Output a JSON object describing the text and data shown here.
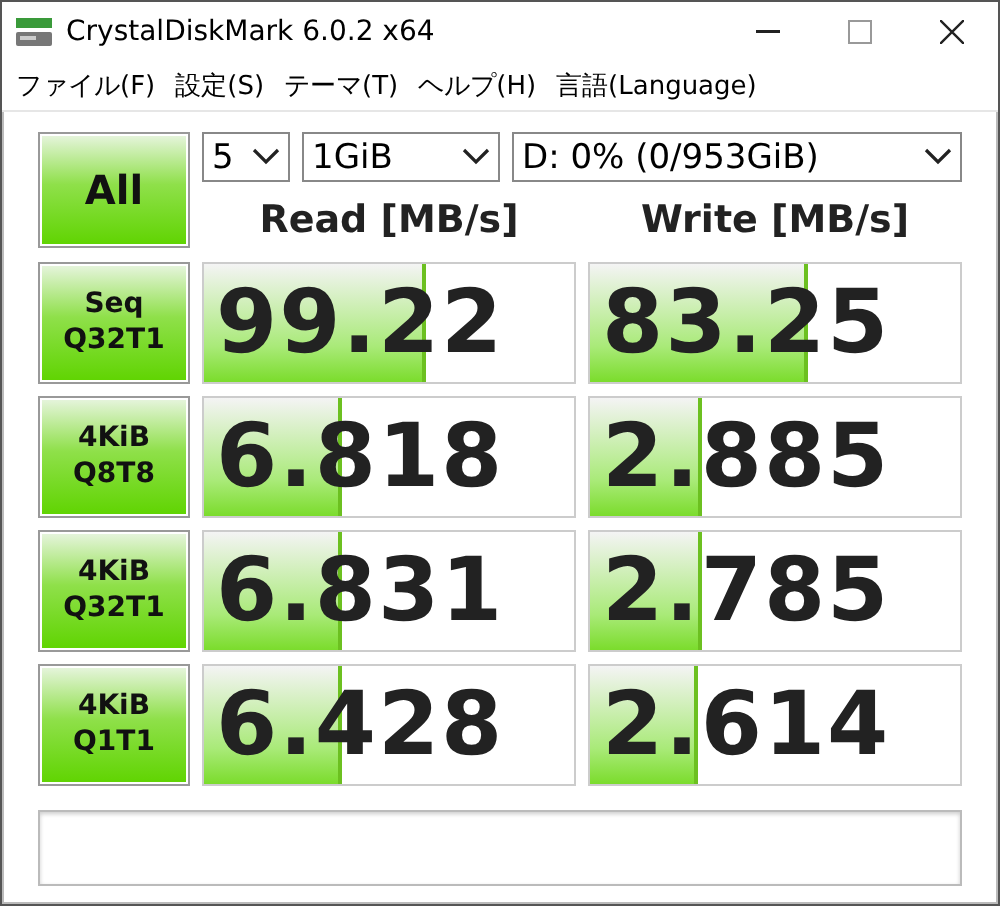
{
  "window": {
    "title": "CrystalDiskMark 6.0.2 x64"
  },
  "menu": [
    "ファイル(F)",
    "設定(S)",
    "テーマ(T)",
    "ヘルプ(H)",
    "言語(Language)"
  ],
  "all_button": "All",
  "selectors": [
    {
      "value": "5"
    },
    {
      "value": "1GiB"
    },
    {
      "value": "D: 0% (0/953GiB)"
    }
  ],
  "columns": [
    "Read [MB/s]",
    "Write [MB/s]"
  ],
  "rows": [
    {
      "label": "Seq Q32T1",
      "read": {
        "value": "99.22",
        "level": 0.59
      },
      "write": {
        "value": "83.25",
        "level": 0.58
      }
    },
    {
      "label": "4KiB Q8T8",
      "read": {
        "value": "6.818",
        "level": 0.36
      },
      "write": {
        "value": "2.885",
        "level": 0.29
      }
    },
    {
      "label": "4KiB Q32T1",
      "read": {
        "value": "6.831",
        "level": 0.36
      },
      "write": {
        "value": "2.785",
        "level": 0.29
      }
    },
    {
      "label": "4KiB Q1T1",
      "read": {
        "value": "6.428",
        "level": 0.36
      },
      "write": {
        "value": "2.614",
        "level": 0.28
      }
    }
  ]
}
